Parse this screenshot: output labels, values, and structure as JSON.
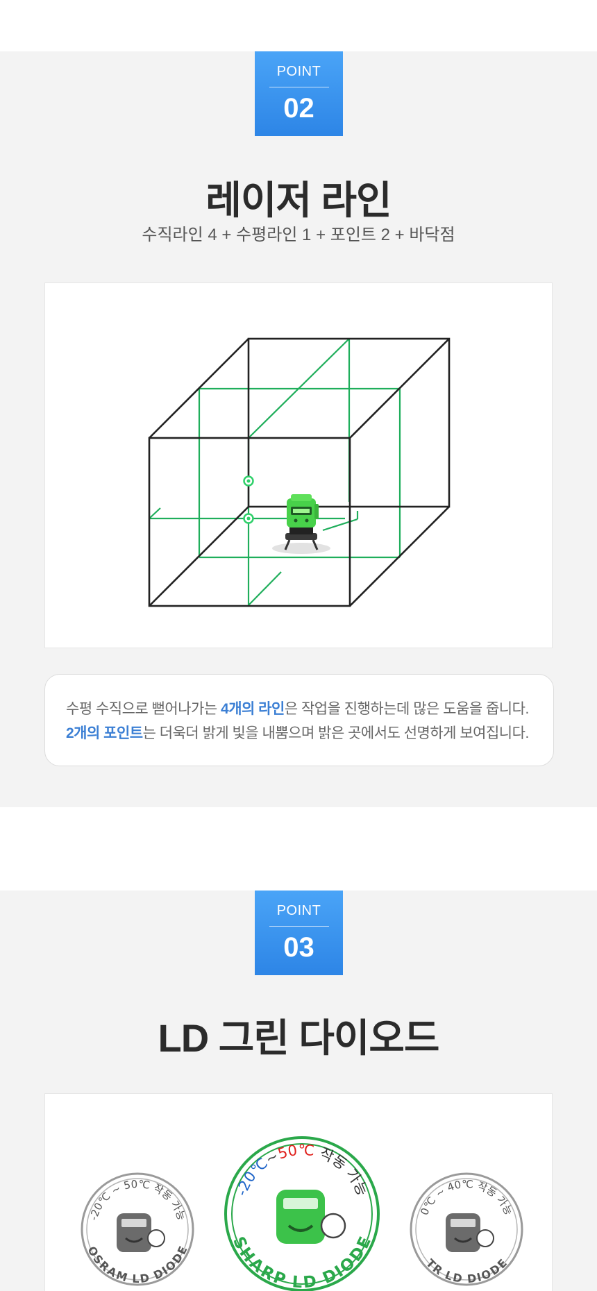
{
  "point2": {
    "badge_label": "POINT",
    "badge_number": "02",
    "title": "레이저 라인",
    "subtitle": "수직라인 4 + 수평라인 1 + 포인트 2 + 바닥점",
    "description": {
      "line1_pre": "수평 수직으로 뻗어나가는 ",
      "line1_highlight": "4개의 라인",
      "line1_post": "은 작업을 진행하는데 많은 도움을 줍니다.",
      "line2_highlight": "2개의 포인트",
      "line2_post": "는 더욱더 밝게 빛을 내뿜으며 밝은 곳에서도 선명하게 보여집니다."
    }
  },
  "point3": {
    "badge_label": "POINT",
    "badge_number": "03",
    "title": "LD 그린 다이오드",
    "diodes": [
      {
        "range_text": "-20℃ ~ 50℃ 작동 가능",
        "brand_text": "OSRAM LD DIODE"
      },
      {
        "range_low": "-20℃",
        "range_high": "50℃",
        "range_sep": "~",
        "range_suffix": "작동 가능",
        "brand_text": "SHARP LD DIODE"
      },
      {
        "range_text": "0℃ ~ 40℃ 작동 가능",
        "brand_text": "TR LD DIODE"
      }
    ]
  },
  "colors": {
    "accent_blue": "#3b7fd4",
    "badge_blue": "#3a93ef",
    "laser_green": "#1fae5b",
    "section_bg": "#f3f3f3",
    "temp_red": "#e0201c",
    "temp_blue": "#1e64c8"
  },
  "icons": [
    "laser-level-device-icon",
    "diode-mascot-icon"
  ]
}
